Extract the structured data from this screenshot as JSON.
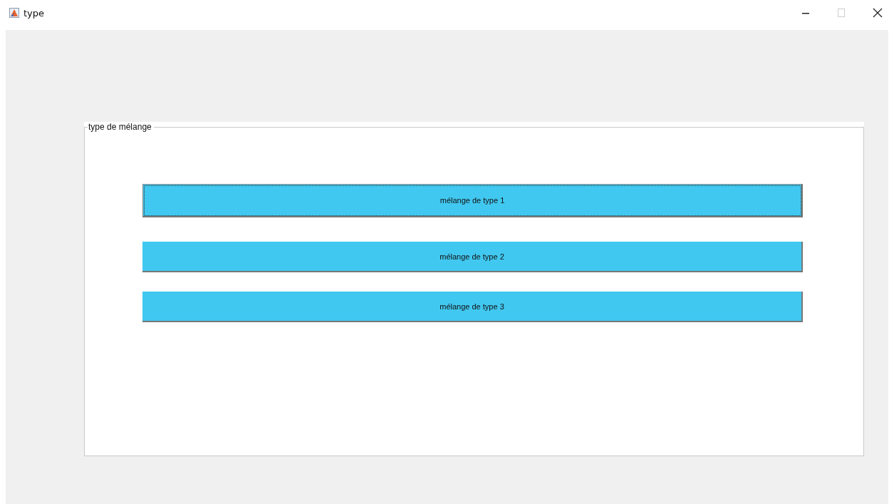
{
  "window": {
    "title": "type"
  },
  "panel": {
    "title": "type de mélange",
    "buttons": [
      {
        "label": "mélange de type 1",
        "focused": true
      },
      {
        "label": "mélange de type 2",
        "focused": false
      },
      {
        "label": "mélange de type 3",
        "focused": false
      }
    ]
  }
}
